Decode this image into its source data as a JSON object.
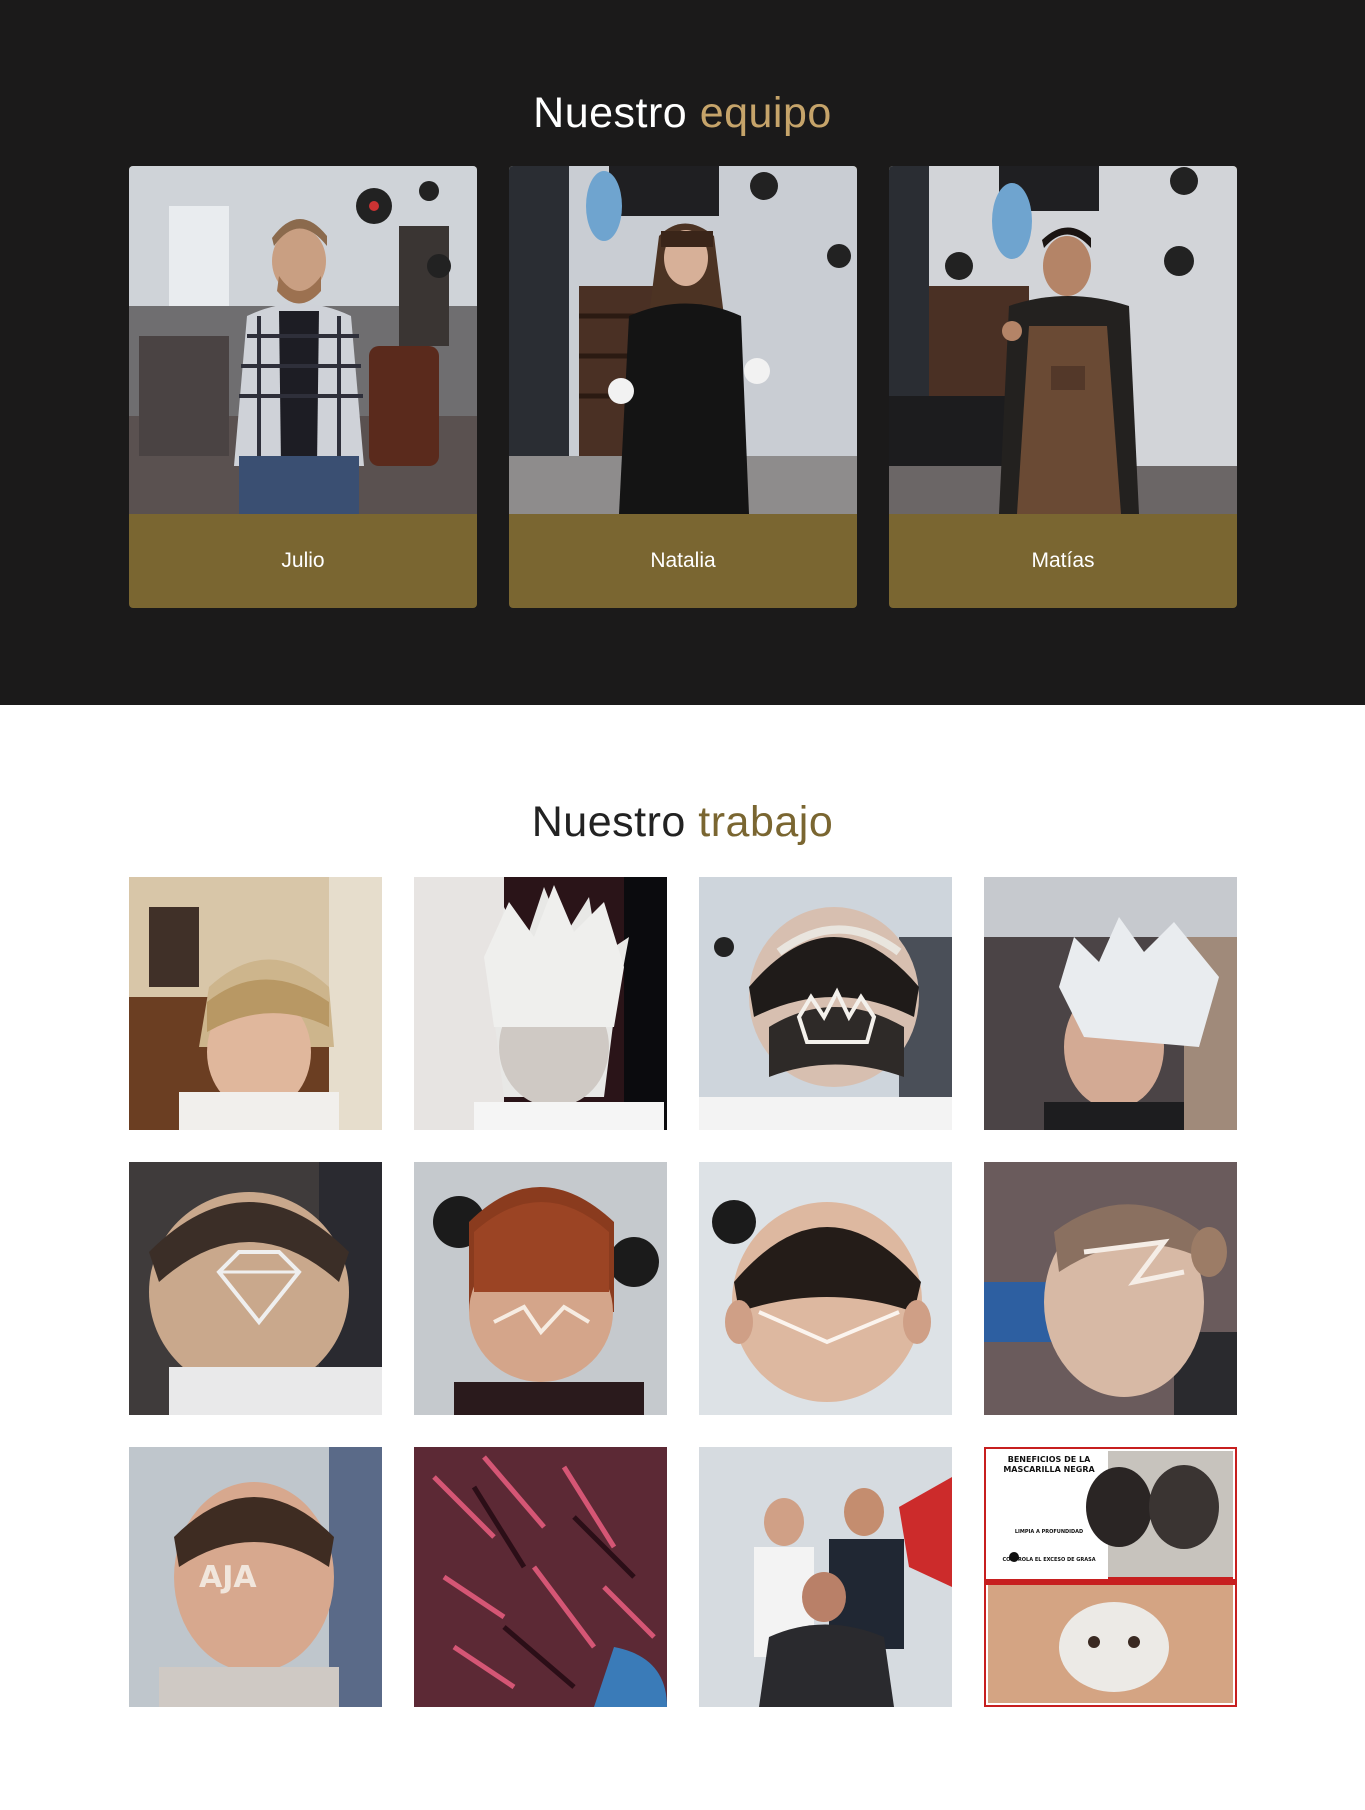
{
  "team": {
    "title_main": "Nuestro",
    "title_accent": "equipo",
    "members": [
      {
        "name": "Julio",
        "photo": "barber-julio-photo"
      },
      {
        "name": "Natalia",
        "photo": "barber-natalia-photo"
      },
      {
        "name": "Matías",
        "photo": "barber-matias-photo"
      }
    ]
  },
  "work": {
    "title_main": "Nuestro",
    "title_accent": "trabajo",
    "gallery": [
      "haircut-blonde-fringe-photo",
      "haircut-platinum-spikes-photo",
      "haircut-crown-design-photo",
      "haircut-white-textured-photo",
      "haircut-diamond-design-photo",
      "haircut-copper-lines-photo",
      "haircut-v-line-fade-photo",
      "haircut-lightning-design-photo",
      "haircut-letters-design-photo",
      "haircut-red-spikes-photo",
      "barbers-group-photo",
      "black-mask-poster"
    ],
    "poster": {
      "heading": "BENEFICIOS DE LA MASCARILLA NEGRA",
      "line1": "LIMPIA A PROFUNDIDAD",
      "line2": "CONTROLA EL EXCESO DE GRASA"
    }
  },
  "colors": {
    "dark_bg": "#1b1a1a",
    "gold_accent": "#c6a46a",
    "card_gold": "#7a6631",
    "light_bg": "#ffffff"
  }
}
